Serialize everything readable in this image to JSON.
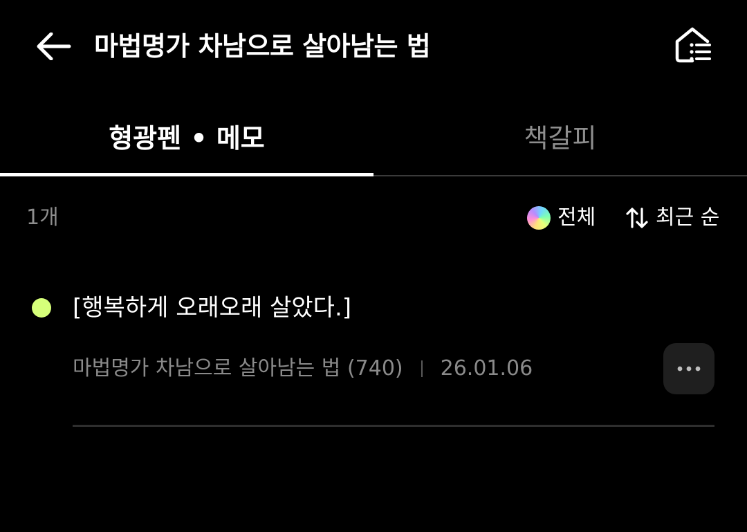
{
  "header": {
    "back_icon": "arrow-left-icon",
    "title": "마법명가 차남으로 살아남는 법",
    "toc_icon": "home-list-icon"
  },
  "tabs": [
    {
      "label": "형광펜 • 메모",
      "active": true
    },
    {
      "label": "책갈피",
      "active": false
    }
  ],
  "filter": {
    "count": "1개",
    "color_filter_label": "전체",
    "color_filter_icon": "rainbow-color-dot-icon",
    "sort_icon": "sort-arrows-icon",
    "sort_label": "최근 순"
  },
  "memos": [
    {
      "text": "[행복하게 오래오래 살았다.]",
      "highlight_color": "#d6ff7a",
      "book_ref": "마법명가 차남으로 살아남는 법 (740)",
      "date": "26.01.06",
      "more_icon": "more-horizontal-icon"
    }
  ],
  "colors": {
    "background": "#000000",
    "text_primary": "#ffffff",
    "text_secondary": "#8e8e8e",
    "highlight_green": "#d6ff7a",
    "button_bg": "#1f1f1f"
  }
}
